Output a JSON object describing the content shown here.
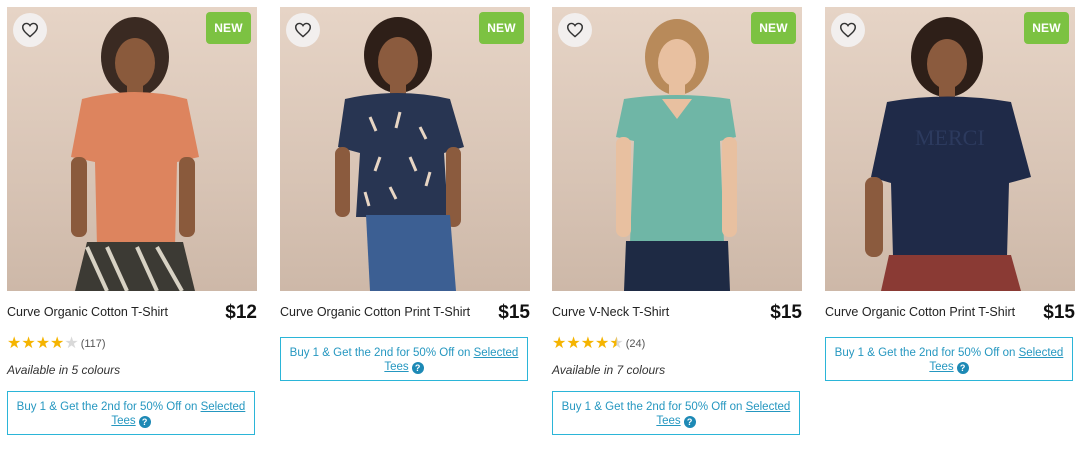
{
  "products": [
    {
      "name": "Curve Organic Cotton T-Shirt",
      "price": "$12",
      "badge": "NEW",
      "rating_count": "(117)",
      "colours": "Available in 5 colours",
      "promo_text": "Buy 1 & Get the 2nd for 50% Off on ",
      "promo_link_1": "Selected",
      "promo_link_2": "Tees",
      "rating": 4.0,
      "shirt_color": "#dd845e"
    },
    {
      "name": "Curve Organic Cotton Print T-Shirt",
      "price": "$15",
      "badge": "NEW",
      "promo_text": "Buy 1 & Get the 2nd for 50% Off on ",
      "promo_link_1": "Selected",
      "promo_link_2": "Tees",
      "shirt_color": "#283552"
    },
    {
      "name": "Curve V-Neck T-Shirt",
      "price": "$15",
      "badge": "NEW",
      "rating_count": "(24)",
      "colours": "Available in 7 colours",
      "promo_text": "Buy 1 & Get the 2nd for 50% Off on ",
      "promo_link_1": "Selected",
      "promo_link_2": "Tees",
      "rating": 4.5,
      "shirt_color": "#6fb6a6"
    },
    {
      "name": "Curve Organic Cotton Print T-Shirt",
      "price": "$15",
      "badge": "NEW",
      "promo_text": "Buy 1 & Get the 2nd for 50% Off on ",
      "promo_link_1": "Selected",
      "promo_link_2": "Tees",
      "shirt_color": "#1f2a48"
    }
  ],
  "icons": {
    "wishlist": "heart-outline-icon",
    "help": "question-circle-icon",
    "star": "star-icon"
  },
  "colors": {
    "badge": "#7cc242",
    "promo_border": "#2bb5d8",
    "promo_text": "#2597c0",
    "star": "#f5b400"
  }
}
